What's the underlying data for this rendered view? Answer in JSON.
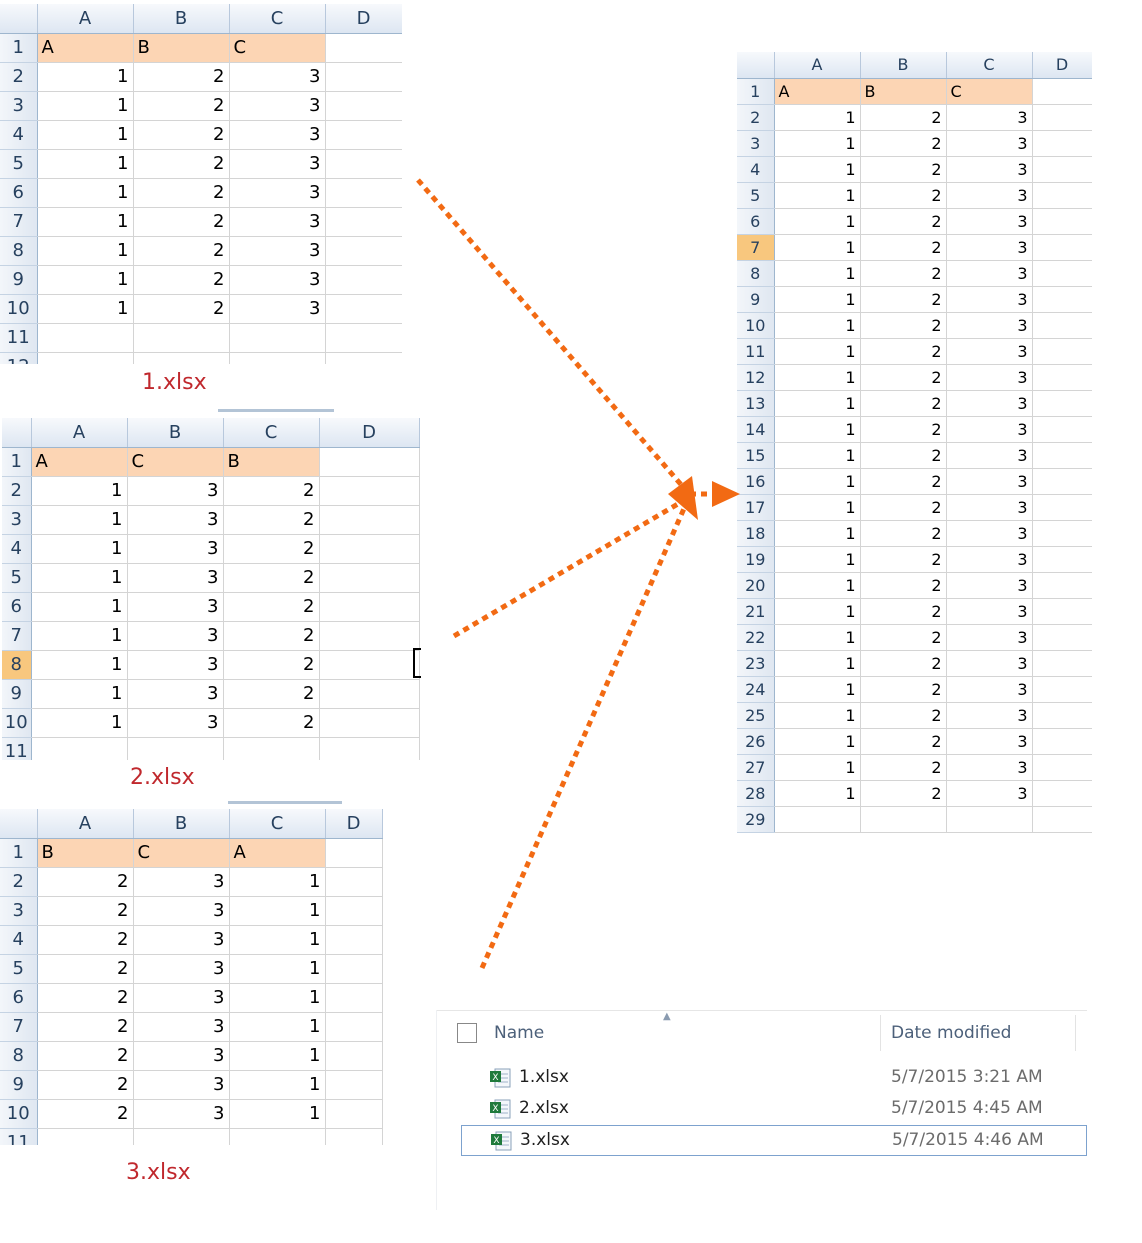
{
  "columns": [
    "A",
    "B",
    "C",
    "D"
  ],
  "sheet1": {
    "label": "1.xlsx",
    "header": [
      "A",
      "B",
      "C"
    ],
    "rows": [
      [
        1,
        2,
        3
      ],
      [
        1,
        2,
        3
      ],
      [
        1,
        2,
        3
      ],
      [
        1,
        2,
        3
      ],
      [
        1,
        2,
        3
      ],
      [
        1,
        2,
        3
      ],
      [
        1,
        2,
        3
      ],
      [
        1,
        2,
        3
      ],
      [
        1,
        2,
        3
      ]
    ]
  },
  "sheet2": {
    "label": "2.xlsx",
    "header": [
      "A",
      "C",
      "B"
    ],
    "rows": [
      [
        1,
        3,
        2
      ],
      [
        1,
        3,
        2
      ],
      [
        1,
        3,
        2
      ],
      [
        1,
        3,
        2
      ],
      [
        1,
        3,
        2
      ],
      [
        1,
        3,
        2
      ],
      [
        1,
        3,
        2
      ],
      [
        1,
        3,
        2
      ],
      [
        1,
        3,
        2
      ]
    ],
    "selected_row": 8
  },
  "sheet3": {
    "label": "3.xlsx",
    "header": [
      "B",
      "C",
      "A"
    ],
    "rows": [
      [
        2,
        3,
        1
      ],
      [
        2,
        3,
        1
      ],
      [
        2,
        3,
        1
      ],
      [
        2,
        3,
        1
      ],
      [
        2,
        3,
        1
      ],
      [
        2,
        3,
        1
      ],
      [
        2,
        3,
        1
      ],
      [
        2,
        3,
        1
      ],
      [
        2,
        3,
        1
      ]
    ]
  },
  "combined": {
    "header": [
      "A",
      "B",
      "C"
    ],
    "rows": [
      [
        1,
        2,
        3
      ],
      [
        1,
        2,
        3
      ],
      [
        1,
        2,
        3
      ],
      [
        1,
        2,
        3
      ],
      [
        1,
        2,
        3
      ],
      [
        1,
        2,
        3
      ],
      [
        1,
        2,
        3
      ],
      [
        1,
        2,
        3
      ],
      [
        1,
        2,
        3
      ],
      [
        1,
        2,
        3
      ],
      [
        1,
        2,
        3
      ],
      [
        1,
        2,
        3
      ],
      [
        1,
        2,
        3
      ],
      [
        1,
        2,
        3
      ],
      [
        1,
        2,
        3
      ],
      [
        1,
        2,
        3
      ],
      [
        1,
        2,
        3
      ],
      [
        1,
        2,
        3
      ],
      [
        1,
        2,
        3
      ],
      [
        1,
        2,
        3
      ],
      [
        1,
        2,
        3
      ],
      [
        1,
        2,
        3
      ],
      [
        1,
        2,
        3
      ],
      [
        1,
        2,
        3
      ],
      [
        1,
        2,
        3
      ],
      [
        1,
        2,
        3
      ],
      [
        1,
        2,
        3
      ]
    ],
    "selected_row": 7
  },
  "explorer": {
    "name_header": "Name",
    "date_header": "Date modified",
    "files": [
      {
        "name": "1.xlsx",
        "modified": "5/7/2015 3:21 AM"
      },
      {
        "name": "2.xlsx",
        "modified": "5/7/2015 4:45 AM"
      },
      {
        "name": "3.xlsx",
        "modified": "5/7/2015 4:46 AM"
      }
    ],
    "selected_index": 2
  },
  "colors": {
    "header_fill": "#fcd5b4",
    "label_red": "#c0282d",
    "arrow_orange": "#f26a13",
    "row_select": "#f8c77e"
  }
}
